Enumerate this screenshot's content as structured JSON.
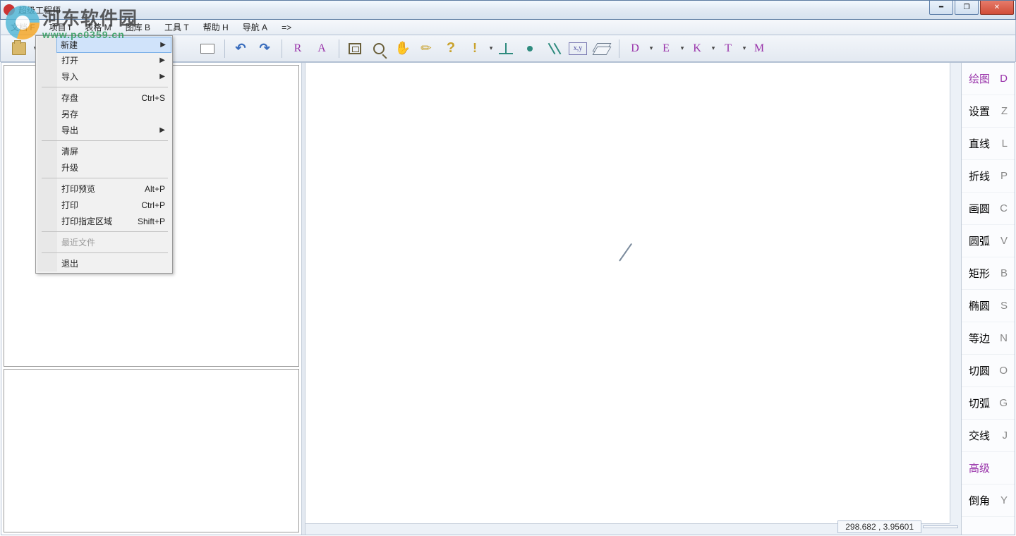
{
  "window": {
    "title": "超级工程师"
  },
  "menubar": {
    "items": [
      "文档 F",
      "项目 I",
      "表格 M",
      "图库 B",
      "工具 T",
      "帮助 H",
      "导航 A",
      "=>"
    ]
  },
  "file_menu": {
    "new": "新建",
    "open": "打开",
    "import": "导入",
    "save": "存盘",
    "save_shortcut": "Ctrl+S",
    "saveas": "另存",
    "export": "导出",
    "clear": "清屏",
    "upgrade": "升级",
    "preview": "打印预览",
    "preview_shortcut": "Alt+P",
    "print": "打印",
    "print_shortcut": "Ctrl+P",
    "print_region": "打印指定区域",
    "print_region_shortcut": "Shift+P",
    "recent": "最近文件",
    "exit": "退出"
  },
  "toolbar": {
    "letters": [
      "R",
      "A"
    ],
    "xy": "x,y",
    "right_letters": [
      "D",
      "E",
      "K",
      "T",
      "M"
    ]
  },
  "right_panel": {
    "items": [
      {
        "label": "绘图",
        "key": "D",
        "hi": true
      },
      {
        "label": "设置",
        "key": "Z"
      },
      {
        "label": "直线",
        "key": "L"
      },
      {
        "label": "折线",
        "key": "P"
      },
      {
        "label": "画圆",
        "key": "C"
      },
      {
        "label": "圆弧",
        "key": "V"
      },
      {
        "label": "矩形",
        "key": "B"
      },
      {
        "label": "椭圆",
        "key": "S"
      },
      {
        "label": "等边",
        "key": "N"
      },
      {
        "label": "切圆",
        "key": "O"
      },
      {
        "label": "切弧",
        "key": "G"
      },
      {
        "label": "交线",
        "key": "J"
      },
      {
        "label": "高级",
        "key": "",
        "hi": true
      },
      {
        "label": "倒角",
        "key": "Y"
      }
    ]
  },
  "status": {
    "coords": "298.682   , 3.95601"
  },
  "watermark": {
    "line1": "河东软件园",
    "line2": "www.pc0359.cn"
  }
}
